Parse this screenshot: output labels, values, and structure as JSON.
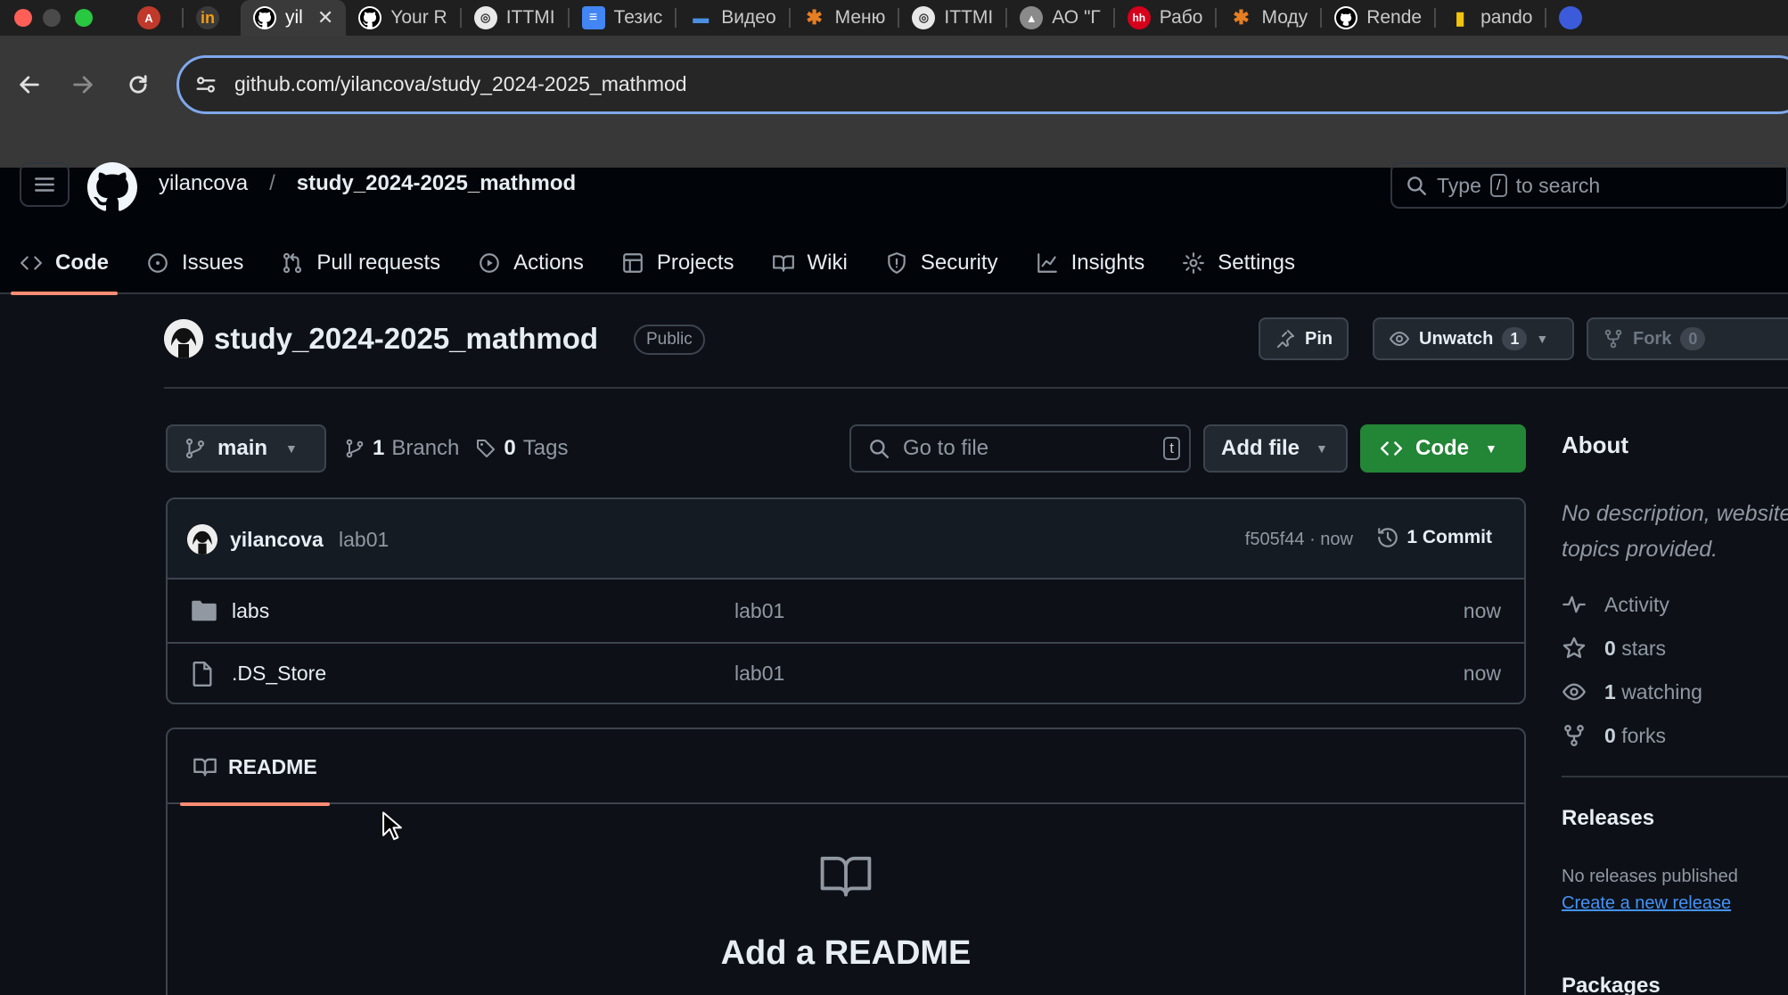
{
  "browser": {
    "tabs": [
      {
        "label": "",
        "icon": "app-icon"
      },
      {
        "label": "",
        "icon": "in-icon"
      },
      {
        "label": "yil",
        "icon": "github-icon",
        "active": true
      },
      {
        "label": "Your R",
        "icon": "github-icon"
      },
      {
        "label": "ITTMI",
        "icon": "chrome-icon"
      },
      {
        "label": "Тезис",
        "icon": "docs-icon"
      },
      {
        "label": "Видео",
        "icon": "video-icon"
      },
      {
        "label": "Меню",
        "icon": "joomla-icon"
      },
      {
        "label": "ITTMI",
        "icon": "chrome-icon"
      },
      {
        "label": "АО \"Г",
        "icon": "org-icon"
      },
      {
        "label": "Рабо",
        "icon": "hh-icon"
      },
      {
        "label": "Моду",
        "icon": "joomla-icon"
      },
      {
        "label": "Rende",
        "icon": "github-icon"
      },
      {
        "label": "pando",
        "icon": "bottle-icon"
      }
    ],
    "url": "github.com/yilancova/study_2024-2025_mathmod"
  },
  "header": {
    "owner": "yilancova",
    "separator": "/",
    "repo": "study_2024-2025_mathmod",
    "search_prefix": "Type",
    "search_key": "/",
    "search_suffix": "to search"
  },
  "repo_nav": {
    "items": [
      {
        "label": "Code",
        "icon": "code-icon",
        "active": true
      },
      {
        "label": "Issues",
        "icon": "issue-icon"
      },
      {
        "label": "Pull requests",
        "icon": "pull-request-icon"
      },
      {
        "label": "Actions",
        "icon": "play-icon"
      },
      {
        "label": "Projects",
        "icon": "table-icon"
      },
      {
        "label": "Wiki",
        "icon": "book-icon"
      },
      {
        "label": "Security",
        "icon": "shield-icon"
      },
      {
        "label": "Insights",
        "icon": "graph-icon"
      },
      {
        "label": "Settings",
        "icon": "gear-icon"
      }
    ]
  },
  "repo": {
    "name": "study_2024-2025_mathmod",
    "visibility": "Public",
    "pin_label": "Pin",
    "unwatch_label": "Unwatch",
    "watch_count": "1",
    "fork_label": "Fork",
    "fork_count": "0"
  },
  "files_toolbar": {
    "branch": "main",
    "branch_count": "1",
    "branch_label": "Branch",
    "tag_count": "0",
    "tag_label": "Tags",
    "goto_placeholder": "Go to file",
    "goto_key": "t",
    "add_file_label": "Add file",
    "code_label": "Code"
  },
  "latest_commit": {
    "author": "yilancova",
    "message": "lab01",
    "hash": "f505f44",
    "time": "now",
    "count_label": "1 Commit"
  },
  "files": [
    {
      "name": "labs",
      "type": "folder",
      "message": "lab01",
      "date": "now"
    },
    {
      "name": ".DS_Store",
      "type": "file",
      "message": "lab01",
      "date": "now"
    }
  ],
  "readme": {
    "tab_label": "README",
    "title": "Add a README"
  },
  "about": {
    "title": "About",
    "description": "No description, website, or topics provided.",
    "stats": [
      {
        "icon": "pulse-icon",
        "value": "",
        "label": "Activity"
      },
      {
        "icon": "star-icon",
        "value": "0",
        "label": "stars"
      },
      {
        "icon": "eye-icon",
        "value": "1",
        "label": "watching"
      },
      {
        "icon": "fork-icon",
        "value": "0",
        "label": "forks"
      }
    ]
  },
  "releases": {
    "title": "Releases",
    "empty_text": "No releases published",
    "create_link": "Create a new release"
  },
  "packages": {
    "title": "Packages"
  },
  "colors": {
    "accent_orange": "#fd8c73",
    "green_button": "#238636",
    "link_blue": "#4493f8",
    "background": "#0d1117"
  }
}
